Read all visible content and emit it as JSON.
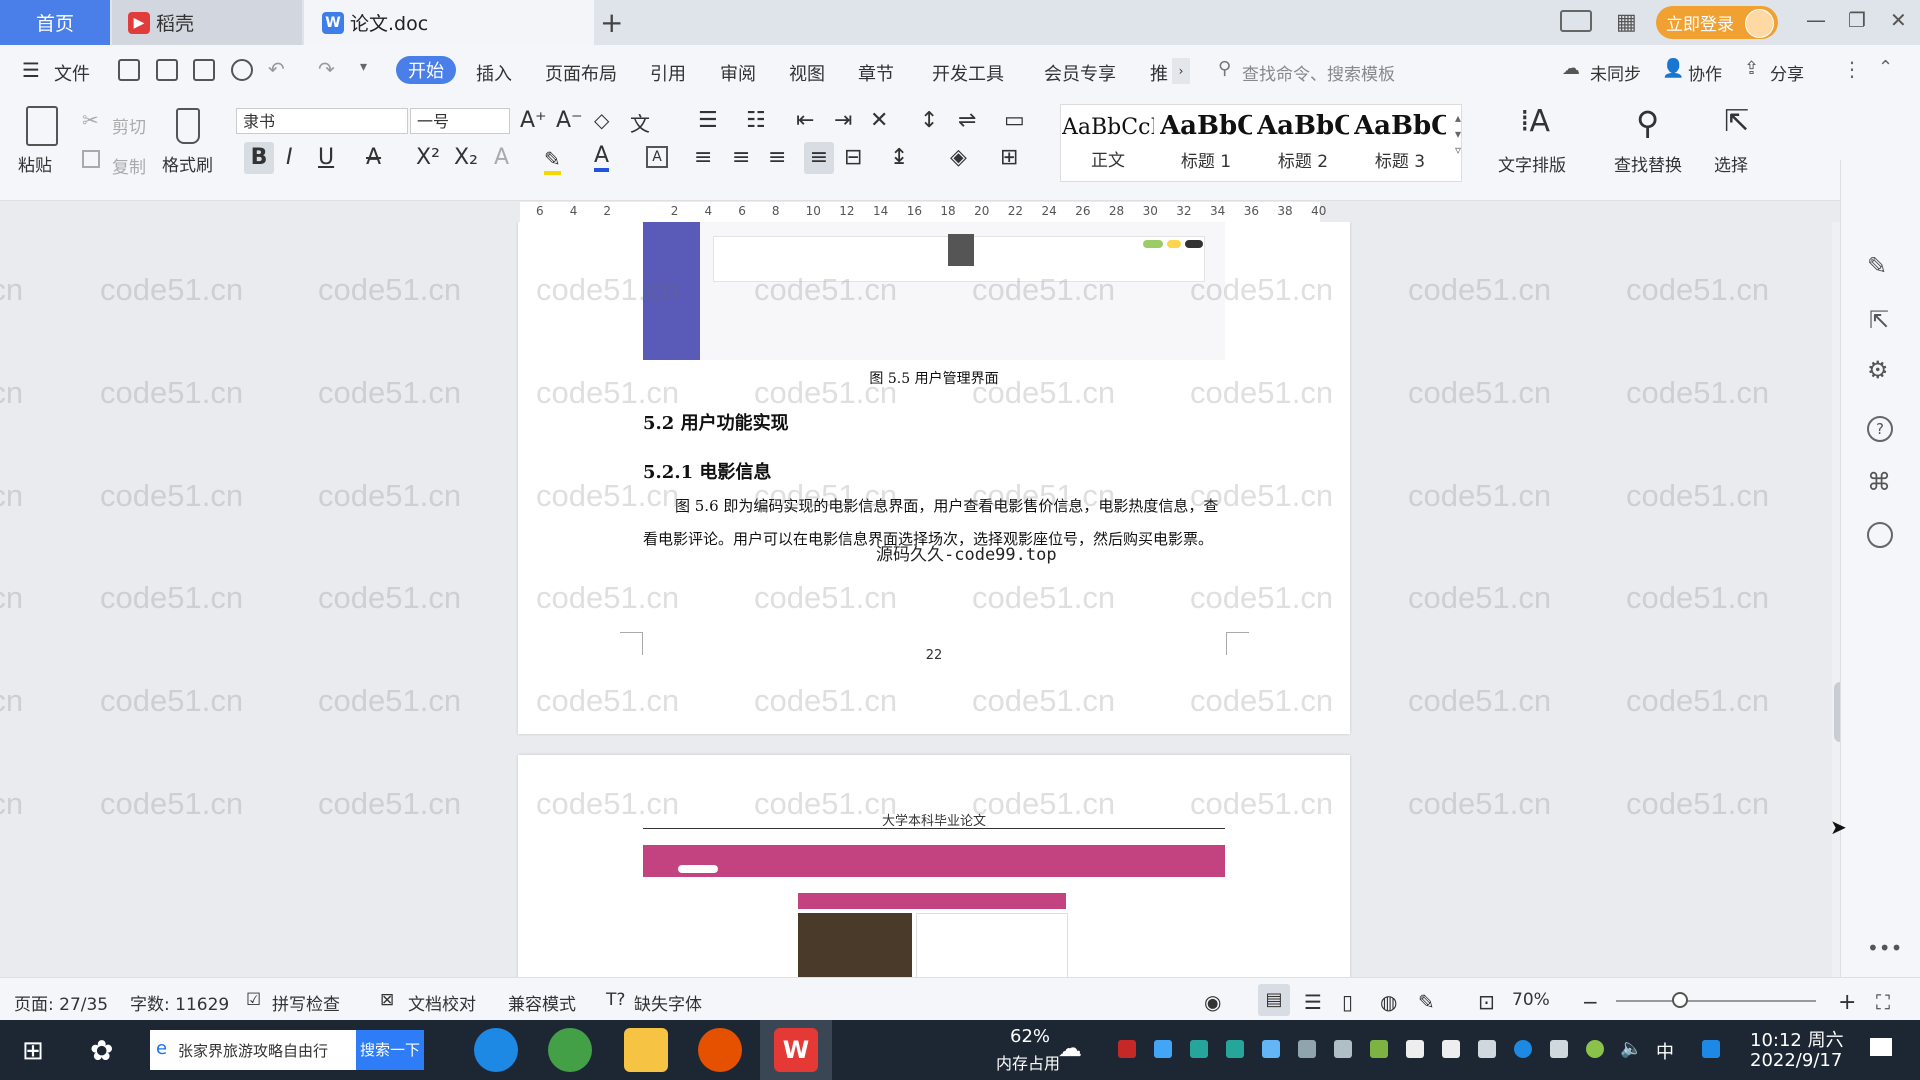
{
  "tabs": {
    "home": "首页",
    "docer": "稻壳",
    "doc": "论文.doc"
  },
  "header": {
    "login": "立即登录"
  },
  "menu": {
    "file": "文件",
    "items": [
      "开始",
      "插入",
      "页面布局",
      "引用",
      "审阅",
      "视图",
      "章节",
      "开发工具",
      "会员专享",
      "推"
    ],
    "search_cmd": "查找命令、搜索模板",
    "sync": "未同步",
    "collab": "协作",
    "share": "分享"
  },
  "ribbon": {
    "paste": "粘贴",
    "cut": "剪切",
    "copy": "复制",
    "format_painter": "格式刷",
    "font": "隶书",
    "font_size": "一号",
    "styles": [
      {
        "sample": "AaBbCcI",
        "name": "正文"
      },
      {
        "sample": "AaBbC",
        "name": "标题 1"
      },
      {
        "sample": "AaBbC",
        "name": "标题 2"
      },
      {
        "sample": "AaBbC",
        "name": "标题 3"
      }
    ],
    "text_layout": "文字排版",
    "find_replace": "查找替换",
    "select": "选择"
  },
  "ruler": {
    "ticks": [
      "6",
      "4",
      "2",
      "",
      "2",
      "4",
      "6",
      "8",
      "10",
      "12",
      "14",
      "16",
      "18",
      "20",
      "22",
      "24",
      "26",
      "28",
      "30",
      "32",
      "34",
      "36",
      "38",
      "40"
    ]
  },
  "document": {
    "figure_caption": "图 5.5 用户管理界面",
    "section": "5.2 用户功能实现",
    "subsection": "5.2.1 电影信息",
    "paragraph": "图 5.6 即为编码实现的电影信息界面，用户查看电影售价信息，电影热度信息，查看电影评论。用户可以在电影信息界面选择场次，选择观影座位号，然后购买电影票。",
    "overlay": "源码久久-code99.top",
    "page_number": "22",
    "page2_header": "大学本科毕业论文",
    "watermark": "code51.cn"
  },
  "status": {
    "page": "页面: 27/35",
    "words": "字数: 11629",
    "spell": "拼写检查",
    "proof": "文档校对",
    "compat": "兼容模式",
    "missing_font": "缺失字体",
    "zoom": "70%"
  },
  "taskbar": {
    "search_text": "张家界旅游攻略自由行",
    "search_btn": "搜索一下",
    "mem_pct": "62%",
    "mem_label": "内存占用",
    "ime": "中",
    "time": "10:12 周六",
    "date": "2022/9/17"
  },
  "colors": {
    "accent": "#4a7ee8",
    "login": "#f0a131",
    "sidebar_purple": "#5a5ab8",
    "pink_banner": "#c2437f"
  }
}
